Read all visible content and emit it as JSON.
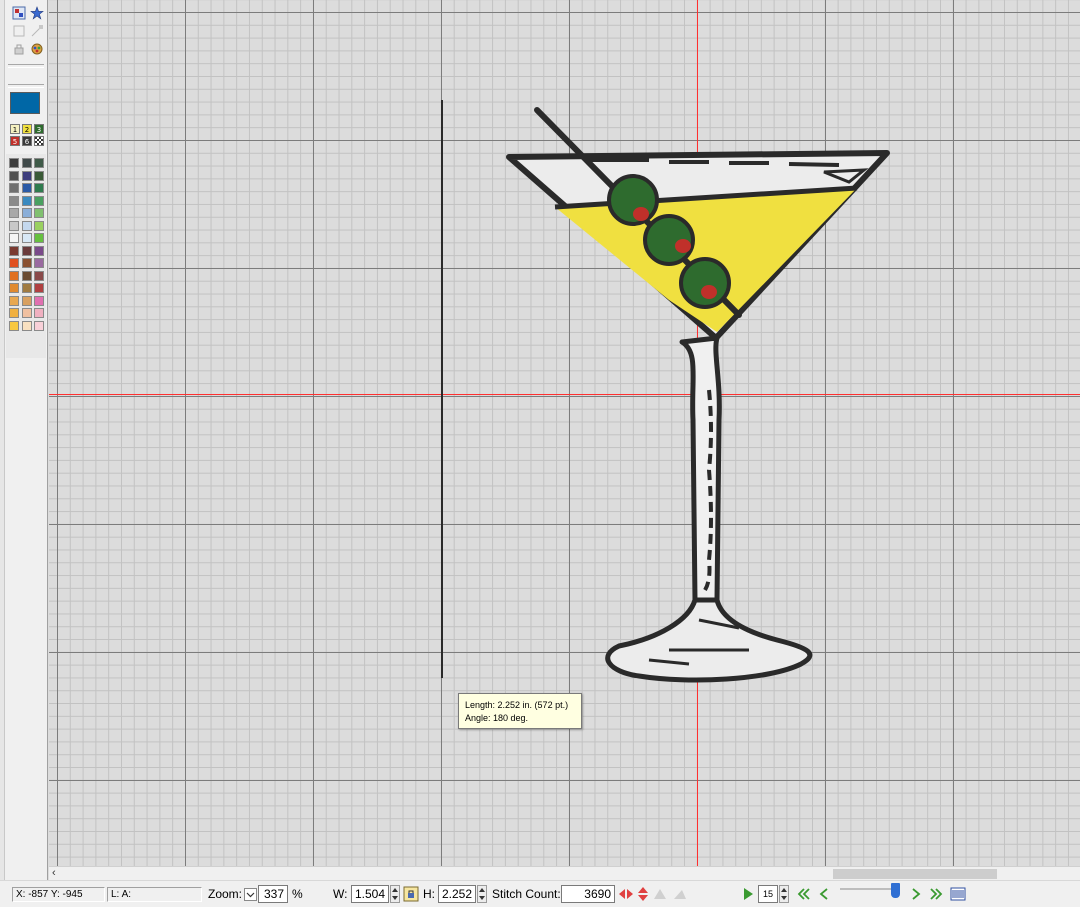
{
  "tooltip": {
    "length_line": "Length: 2.252 in. (572 pt.)",
    "angle_line": "Angle: 180 deg."
  },
  "toolbar_left": {
    "current_color": "#0067a6",
    "slot_labels": [
      "1",
      "2",
      "3",
      "5",
      "6"
    ],
    "palette": [
      [
        "#3c3c3c",
        "#404a4a",
        "#3f5a48"
      ],
      [
        "#505050",
        "#3c3c7c",
        "#3a5a36"
      ],
      [
        "#707070",
        "#2a5aa6",
        "#2f7b4e"
      ],
      [
        "#8a8a8a",
        "#3a8ac0",
        "#4aa060"
      ],
      [
        "#a8a8a8",
        "#8aaed8",
        "#80c070"
      ],
      [
        "#c8c8c8",
        "#c4d8ee",
        "#9ad060"
      ],
      [
        "#f4f4f4",
        "#d8e8f6",
        "#66c040"
      ],
      [
        "#7a3a30",
        "#6a3a3a",
        "#7a4a8a"
      ],
      [
        "#e05020",
        "#8a5030",
        "#9a6aa0"
      ],
      [
        "#e07020",
        "#6a4a30",
        "#8a4a4a"
      ],
      [
        "#e08a30",
        "#a07a40",
        "#b04040"
      ],
      [
        "#e8a850",
        "#d8a060",
        "#e070b0"
      ],
      [
        "#f0b040",
        "#f0c0a0",
        "#f0b0c0"
      ],
      [
        "#f8c840",
        "#f8e0c0",
        "#f8d0d8"
      ]
    ]
  },
  "canvas": {
    "design_colors": {
      "outline": "#2a2a2a",
      "bowl_white": "#ececec",
      "liquid": "#f0e040",
      "olive": "#2e6b2e",
      "pimento": "#c0302a",
      "stem": "#f0f0f0"
    }
  },
  "statusbar": {
    "coords": "X: -857  Y: -945",
    "layer": "L: A:",
    "zoom_label": "Zoom:",
    "zoom_value": "337",
    "zoom_unit": "%",
    "w_label": "W:",
    "w_value": "1.504",
    "h_label": "H:",
    "h_value": "2.252",
    "stitch_label": "Stitch Count:",
    "stitch_value": "3690",
    "speed_value": "15"
  }
}
